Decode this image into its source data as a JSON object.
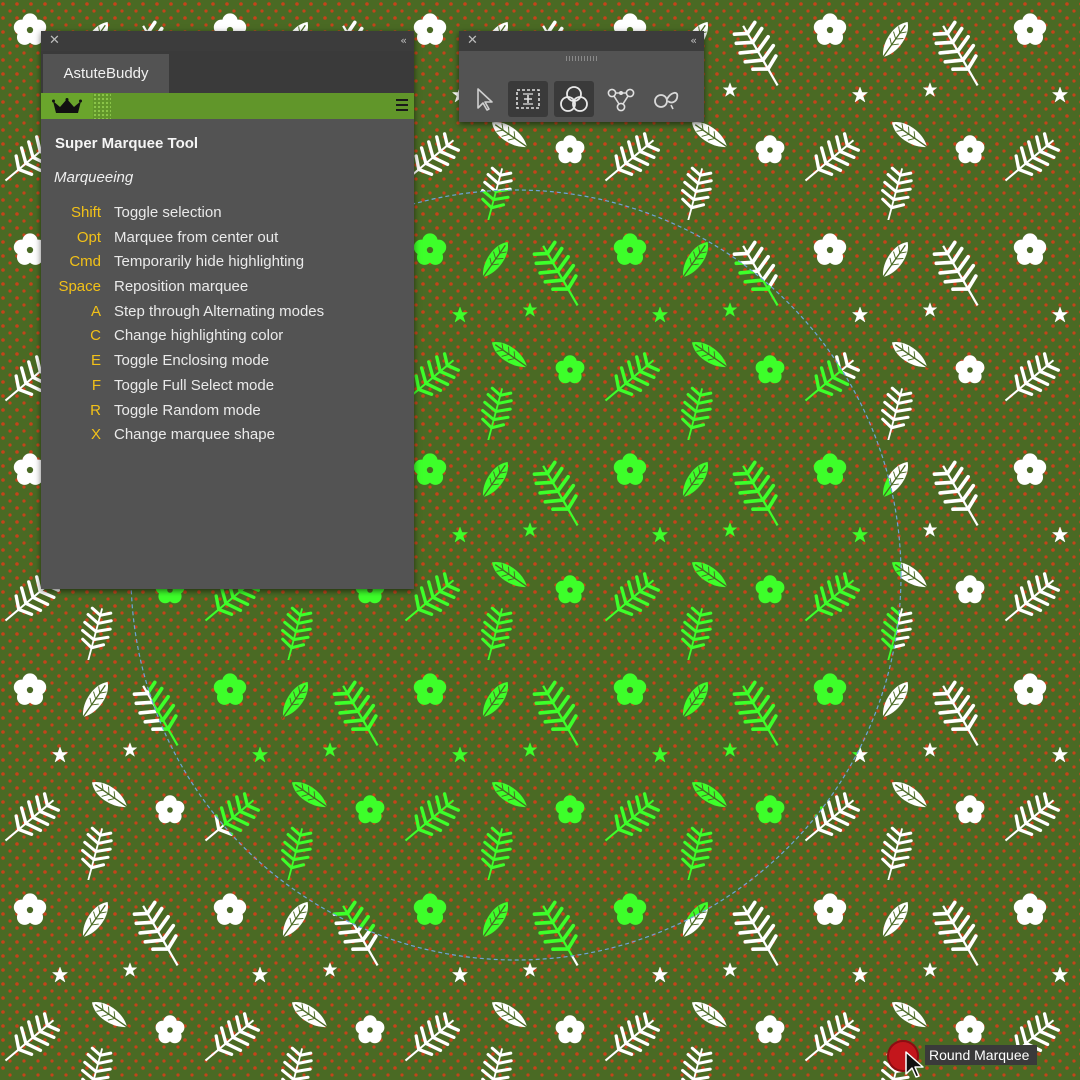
{
  "colors": {
    "background": "#4a6a24",
    "dots": "#c5431a",
    "leaf_white": "#ffffff",
    "leaf_highlight": "#3dff2a",
    "marquee": "#6ea3d8",
    "panel_bg": "#535353",
    "key_color": "#f2c118",
    "brand_green": "#61962a"
  },
  "panel": {
    "tab_label": "AstuteBuddy",
    "tool_title": "Super Marquee Tool",
    "section": "Marqueeing",
    "shortcuts": [
      {
        "key": "Shift",
        "desc": "Toggle selection"
      },
      {
        "key": "Opt",
        "desc": "Marquee from center out"
      },
      {
        "key": "Cmd",
        "desc": "Temporarily hide highlighting"
      },
      {
        "key": "Space",
        "desc": "Reposition marquee"
      },
      {
        "key": "A",
        "desc": "Step through Alternating modes"
      },
      {
        "key": "C",
        "desc": "Change highlighting color"
      },
      {
        "key": "E",
        "desc": "Toggle Enclosing mode"
      },
      {
        "key": "F",
        "desc": "Toggle Full Select mode"
      },
      {
        "key": "R",
        "desc": "Toggle Random mode"
      },
      {
        "key": "X",
        "desc": "Change marquee shape"
      }
    ]
  },
  "tools_panel": {
    "tools": [
      {
        "icon": "arrow-selection-icon",
        "active": false
      },
      {
        "icon": "super-marquee-icon",
        "active": true
      },
      {
        "icon": "overlapping-circles-icon",
        "active": true
      },
      {
        "icon": "node-triangle-icon",
        "active": false
      },
      {
        "icon": "lasso-icon",
        "active": false
      }
    ]
  },
  "tooltip": {
    "label": "Round Marquee"
  }
}
